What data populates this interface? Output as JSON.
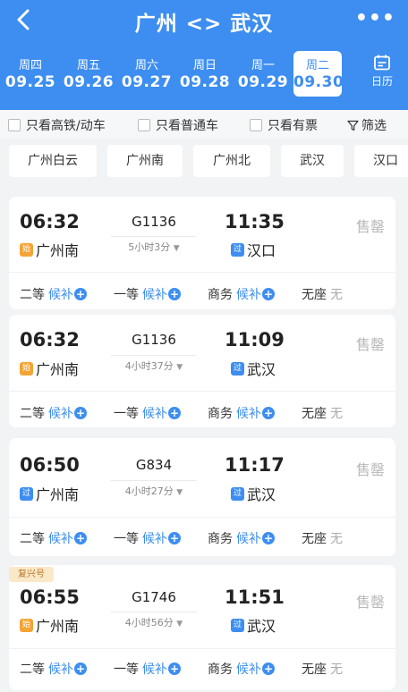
{
  "header": {
    "title": "广州 <> 武汉",
    "more": "•••"
  },
  "dates": [
    {
      "weekday": "周四",
      "date": "09.25"
    },
    {
      "weekday": "周五",
      "date": "09.26"
    },
    {
      "weekday": "周六",
      "date": "09.27"
    },
    {
      "weekday": "周日",
      "date": "09.28"
    },
    {
      "weekday": "周一",
      "date": "09.29"
    },
    {
      "weekday": "周二",
      "date": "09.30"
    }
  ],
  "calendar_label": "日历",
  "filters": {
    "high_speed": "只看高铁/动车",
    "normal": "只看普通车",
    "available": "只看有票",
    "screen": "筛选"
  },
  "stations": [
    "广州白云",
    "广州南",
    "广州北",
    "武汉",
    "汉口"
  ],
  "trains": [
    {
      "dep_time": "06:32",
      "train_no": "G1136",
      "duration": "5小时3分",
      "arr_time": "11:35",
      "dep_type": "始",
      "dep_station": "广州南",
      "arr_type": "过",
      "arr_station": "汉口",
      "status": "售罄",
      "seats": [
        {
          "cls": "二等",
          "avail": "候补"
        },
        {
          "cls": "一等",
          "avail": "候补"
        },
        {
          "cls": "商务",
          "avail": "候补"
        },
        {
          "cls": "无座",
          "avail": "无"
        }
      ]
    },
    {
      "dep_time": "06:32",
      "train_no": "G1136",
      "duration": "4小时37分",
      "arr_time": "11:09",
      "dep_type": "始",
      "dep_station": "广州南",
      "arr_type": "过",
      "arr_station": "武汉",
      "status": "售罄",
      "seats": [
        {
          "cls": "二等",
          "avail": "候补"
        },
        {
          "cls": "一等",
          "avail": "候补"
        },
        {
          "cls": "商务",
          "avail": "候补"
        },
        {
          "cls": "无座",
          "avail": "无"
        }
      ]
    },
    {
      "dep_time": "06:50",
      "train_no": "G834",
      "duration": "4小时27分",
      "arr_time": "11:17",
      "dep_type": "过",
      "dep_station": "广州南",
      "arr_type": "过",
      "arr_station": "武汉",
      "status": "售罄",
      "seats": [
        {
          "cls": "二等",
          "avail": "候补"
        },
        {
          "cls": "一等",
          "avail": "候补"
        },
        {
          "cls": "商务",
          "avail": "候补"
        },
        {
          "cls": "无座",
          "avail": "无"
        }
      ]
    },
    {
      "badge": "复兴号",
      "dep_time": "06:55",
      "train_no": "G1746",
      "duration": "4小时56分",
      "arr_time": "11:51",
      "dep_type": "始",
      "dep_station": "广州南",
      "arr_type": "过",
      "arr_station": "武汉",
      "status": "售罄",
      "seats": [
        {
          "cls": "二等",
          "avail": "候补"
        },
        {
          "cls": "一等",
          "avail": "候补"
        },
        {
          "cls": "商务",
          "avail": "候补"
        },
        {
          "cls": "无座",
          "avail": "无"
        }
      ]
    }
  ],
  "colors": {
    "primary": "#3d8ef0",
    "start_tag": "#f3a435",
    "sold_out": "#b8b8b8"
  }
}
